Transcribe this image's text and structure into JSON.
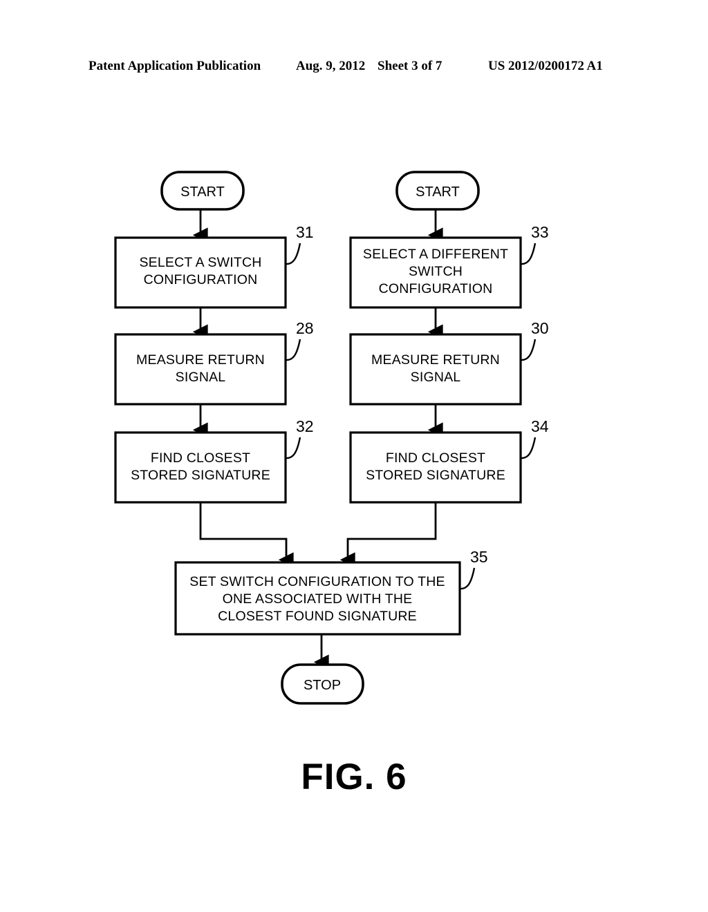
{
  "header": {
    "publication": "Patent Application Publication",
    "date": "Aug. 9, 2012",
    "sheet": "Sheet 3 of 7",
    "number": "US 2012/0200172 A1"
  },
  "figure": {
    "caption": "FIG. 6"
  },
  "colors": {
    "ink": "#000000",
    "paper": "#ffffff"
  },
  "diagram": {
    "type": "flowchart",
    "terminals": [
      {
        "id": "start-left",
        "label": "START"
      },
      {
        "id": "start-right",
        "label": "START"
      },
      {
        "id": "stop",
        "label": "STOP"
      }
    ],
    "nodes": [
      {
        "id": "node-31",
        "ref": "31",
        "column": "left",
        "lines": [
          "SELECT A SWITCH",
          "CONFIGURATION"
        ]
      },
      {
        "id": "node-33",
        "ref": "33",
        "column": "right",
        "lines": [
          "SELECT A DIFFERENT",
          "SWITCH",
          "CONFIGURATION"
        ]
      },
      {
        "id": "node-28",
        "ref": "28",
        "column": "left",
        "lines": [
          "MEASURE RETURN",
          "SIGNAL"
        ]
      },
      {
        "id": "node-30",
        "ref": "30",
        "column": "right",
        "lines": [
          "MEASURE RETURN",
          "SIGNAL"
        ]
      },
      {
        "id": "node-32",
        "ref": "32",
        "column": "left",
        "lines": [
          "FIND CLOSEST",
          "STORED SIGNATURE"
        ]
      },
      {
        "id": "node-34",
        "ref": "34",
        "column": "right",
        "lines": [
          "FIND CLOSEST",
          "STORED SIGNATURE"
        ]
      },
      {
        "id": "node-35",
        "ref": "35",
        "column": "merged",
        "lines": [
          "SET SWITCH CONFIGURATION TO THE",
          "ONE ASSOCIATED WITH THE",
          "CLOSEST FOUND SIGNATURE"
        ]
      }
    ],
    "edges": [
      {
        "from": "start-left",
        "to": "node-31",
        "arrow": true
      },
      {
        "from": "node-31",
        "to": "node-28",
        "arrow": true
      },
      {
        "from": "node-28",
        "to": "node-32",
        "arrow": true
      },
      {
        "from": "start-right",
        "to": "node-33",
        "arrow": true
      },
      {
        "from": "node-33",
        "to": "node-30",
        "arrow": true
      },
      {
        "from": "node-30",
        "to": "node-34",
        "arrow": true
      },
      {
        "from": "node-32",
        "to": "node-35",
        "arrow": true
      },
      {
        "from": "node-34",
        "to": "node-35",
        "arrow": true
      },
      {
        "from": "node-35",
        "to": "stop",
        "arrow": true
      }
    ]
  }
}
